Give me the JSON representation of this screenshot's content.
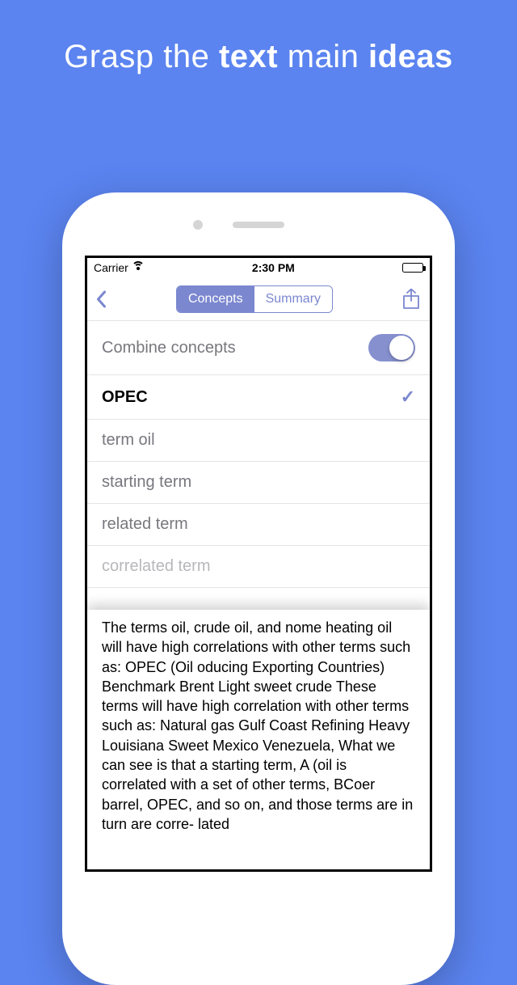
{
  "headline": {
    "p1": "Grasp the ",
    "b1": "text",
    "p2": " main ",
    "b2": "ideas"
  },
  "status": {
    "carrier": "Carrier",
    "time": "2:30 PM"
  },
  "nav": {
    "seg_concepts": "Concepts",
    "seg_summary": "Summary"
  },
  "combine": {
    "label": "Combine concepts",
    "on": true
  },
  "concepts": [
    {
      "label": "OPEC",
      "selected": true
    },
    {
      "label": "term oil",
      "selected": false
    },
    {
      "label": "starting term",
      "selected": false
    },
    {
      "label": "related term",
      "selected": false
    },
    {
      "label": "correlated term",
      "selected": false
    }
  ],
  "summary_text": "The terms oil, crude oil, and nome heating oil will have high correlations with other terms such as: OPEC (Oil oducing Exporting Countries) Benchmark Brent Light sweet crude These terms will have high correlation with other terms such as: Natural gas Gulf Coast Refining Heavy Louisiana Sweet Mexico Venezuela, What we can see is that a starting term, A (oil is correlated with a set of other terms, BCoer barrel, OPEC, and so on, and those terms are in turn are corre- lated"
}
